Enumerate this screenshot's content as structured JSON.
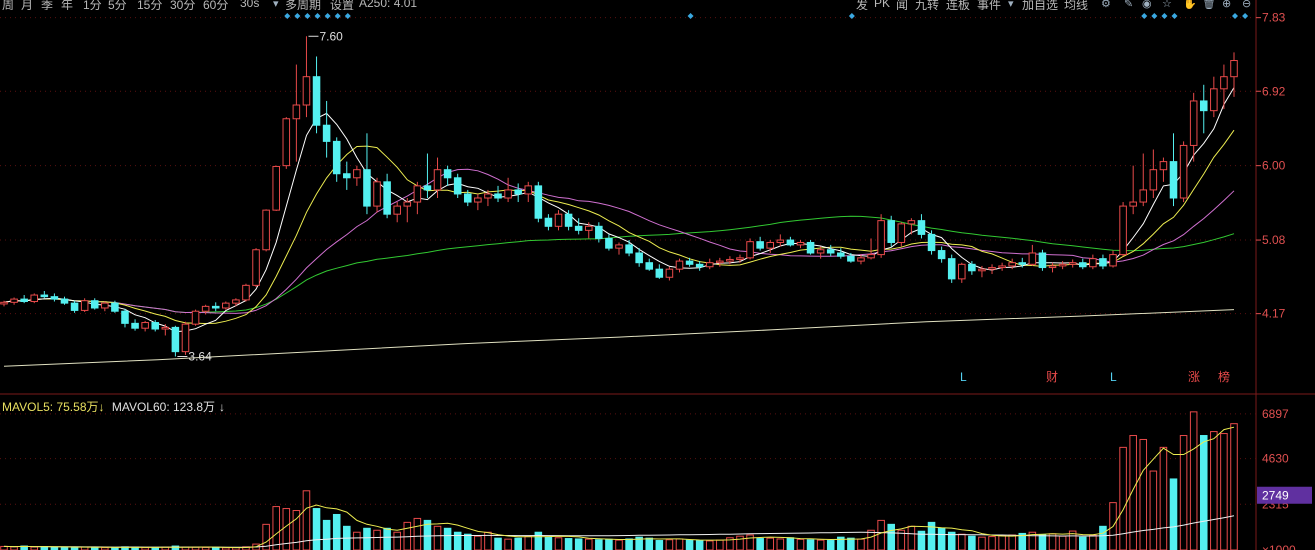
{
  "toolbar": {
    "items": [
      "周",
      "月",
      "季",
      "年",
      "1分",
      "5分",
      "15分",
      "30分",
      "60分",
      "30s",
      "多周期",
      "设置",
      "A250: 4.01"
    ],
    "right_items": [
      "发",
      "PK",
      "闻",
      "九转",
      "连板",
      "事件",
      "加自选",
      "均线"
    ]
  },
  "price_axis": {
    "labels": [
      "7.83",
      "6.92",
      "6.00",
      "5.08",
      "4.17"
    ]
  },
  "volume_axis": {
    "labels": [
      "6897",
      "4630",
      "2315",
      "×1000"
    ],
    "current": "2749"
  },
  "annotations": {
    "high": "7.60",
    "low": "3.64"
  },
  "markers": [
    "L",
    "财",
    "L",
    "涨",
    "榜"
  ],
  "volume_legend": {
    "ma5": "MAVOL5: 75.58万",
    "ma60": "MAVOL60: 123.8万"
  },
  "colors": {
    "up": "#e84a4a",
    "down": "#54f0f0",
    "ma5": "#ffffff",
    "ma10": "#ecec50",
    "ma20": "#d070d0",
    "ma60": "#32c832",
    "ma250": "#e0e0c0",
    "highlight": "#6030a0"
  },
  "icons": [
    "gear-icon",
    "pen-icon",
    "eye-icon",
    "star-icon",
    "hand-icon",
    "trash-icon",
    "plus-icon",
    "minus-icon"
  ],
  "chart_data": {
    "type": "candlestick",
    "ylim": [
      3.3,
      7.9
    ],
    "volume_ylim": [
      0,
      7600
    ],
    "candles": [
      [
        4.29,
        4.33,
        4.26,
        4.31
      ],
      [
        4.31,
        4.37,
        4.28,
        4.35
      ],
      [
        4.35,
        4.4,
        4.3,
        4.32
      ],
      [
        4.32,
        4.42,
        4.3,
        4.4
      ],
      [
        4.4,
        4.45,
        4.36,
        4.38
      ],
      [
        4.38,
        4.42,
        4.32,
        4.35
      ],
      [
        4.35,
        4.38,
        4.28,
        4.3
      ],
      [
        4.3,
        4.33,
        4.18,
        4.21
      ],
      [
        4.21,
        4.36,
        4.19,
        4.33
      ],
      [
        4.33,
        4.36,
        4.22,
        4.24
      ],
      [
        4.24,
        4.32,
        4.2,
        4.3
      ],
      [
        4.3,
        4.33,
        4.18,
        4.2
      ],
      [
        4.2,
        4.23,
        4.0,
        4.05
      ],
      [
        4.05,
        4.1,
        3.96,
        3.99
      ],
      [
        3.99,
        4.08,
        3.95,
        4.06
      ],
      [
        4.06,
        4.09,
        3.95,
        3.98
      ],
      [
        3.98,
        4.04,
        3.9,
        4.0
      ],
      [
        4.0,
        4.02,
        3.64,
        3.7
      ],
      [
        3.7,
        4.07,
        3.66,
        4.04
      ],
      [
        4.04,
        4.22,
        4.02,
        4.2
      ],
      [
        4.2,
        4.28,
        4.16,
        4.26
      ],
      [
        4.26,
        4.31,
        4.2,
        4.24
      ],
      [
        4.24,
        4.32,
        4.22,
        4.3
      ],
      [
        4.3,
        4.36,
        4.26,
        4.34
      ],
      [
        4.34,
        4.54,
        4.32,
        4.52
      ],
      [
        4.52,
        4.98,
        4.5,
        4.96
      ],
      [
        4.96,
        5.46,
        4.94,
        5.45
      ],
      [
        5.45,
        6.0,
        5.44,
        5.99
      ],
      [
        6.0,
        6.6,
        5.96,
        6.58
      ],
      [
        6.58,
        7.25,
        6.05,
        6.75
      ],
      [
        6.75,
        7.6,
        6.6,
        7.1
      ],
      [
        7.1,
        7.35,
        6.4,
        6.5
      ],
      [
        6.5,
        6.8,
        6.1,
        6.3
      ],
      [
        6.3,
        6.35,
        5.8,
        5.9
      ],
      [
        5.9,
        6.05,
        5.7,
        5.85
      ],
      [
        5.85,
        6.0,
        5.75,
        5.95
      ],
      [
        5.95,
        6.4,
        5.4,
        5.5
      ],
      [
        5.5,
        5.85,
        5.42,
        5.8
      ],
      [
        5.8,
        5.9,
        5.35,
        5.4
      ],
      [
        5.4,
        5.55,
        5.3,
        5.5
      ],
      [
        5.5,
        5.6,
        5.3,
        5.55
      ],
      [
        5.55,
        5.8,
        5.4,
        5.75
      ],
      [
        5.75,
        6.15,
        5.6,
        5.7
      ],
      [
        5.7,
        6.1,
        5.6,
        5.95
      ],
      [
        5.95,
        6.0,
        5.75,
        5.85
      ],
      [
        5.85,
        5.9,
        5.6,
        5.65
      ],
      [
        5.65,
        5.7,
        5.5,
        5.55
      ],
      [
        5.55,
        5.65,
        5.45,
        5.6
      ],
      [
        5.6,
        5.7,
        5.5,
        5.65
      ],
      [
        5.65,
        5.75,
        5.55,
        5.6
      ],
      [
        5.6,
        5.85,
        5.55,
        5.7
      ],
      [
        5.7,
        5.78,
        5.55,
        5.65
      ],
      [
        5.65,
        5.8,
        5.55,
        5.75
      ],
      [
        5.75,
        5.8,
        5.3,
        5.35
      ],
      [
        5.35,
        5.4,
        5.2,
        5.25
      ],
      [
        5.25,
        5.45,
        5.2,
        5.4
      ],
      [
        5.4,
        5.45,
        5.2,
        5.25
      ],
      [
        5.25,
        5.35,
        5.15,
        5.2
      ],
      [
        5.2,
        5.3,
        5.1,
        5.25
      ],
      [
        5.25,
        5.3,
        5.05,
        5.1
      ],
      [
        5.1,
        5.15,
        4.95,
        4.98
      ],
      [
        4.98,
        5.05,
        4.9,
        5.02
      ],
      [
        5.02,
        5.08,
        4.88,
        4.92
      ],
      [
        4.92,
        4.98,
        4.75,
        4.8
      ],
      [
        4.8,
        4.85,
        4.7,
        4.72
      ],
      [
        4.72,
        4.78,
        4.6,
        4.62
      ],
      [
        4.62,
        4.75,
        4.58,
        4.72
      ],
      [
        4.72,
        4.85,
        4.68,
        4.82
      ],
      [
        4.82,
        4.86,
        4.75,
        4.78
      ],
      [
        4.78,
        4.82,
        4.7,
        4.75
      ],
      [
        4.75,
        4.85,
        4.72,
        4.8
      ],
      [
        4.8,
        4.86,
        4.75,
        4.82
      ],
      [
        4.82,
        4.88,
        4.78,
        4.84
      ],
      [
        4.84,
        4.9,
        4.8,
        4.86
      ],
      [
        4.86,
        5.1,
        4.84,
        5.06
      ],
      [
        5.06,
        5.12,
        4.95,
        4.98
      ],
      [
        4.98,
        5.08,
        4.92,
        5.05
      ],
      [
        5.05,
        5.15,
        5.0,
        5.08
      ],
      [
        5.08,
        5.12,
        5.0,
        5.02
      ],
      [
        5.02,
        5.08,
        4.98,
        5.05
      ],
      [
        5.05,
        5.08,
        4.9,
        4.92
      ],
      [
        4.92,
        5.0,
        4.85,
        4.96
      ],
      [
        4.96,
        5.02,
        4.88,
        4.92
      ],
      [
        4.92,
        4.98,
        4.85,
        4.88
      ],
      [
        4.88,
        4.92,
        4.8,
        4.82
      ],
      [
        4.82,
        4.9,
        4.78,
        4.86
      ],
      [
        4.86,
        5.1,
        4.84,
        4.9
      ],
      [
        4.9,
        5.4,
        4.86,
        5.32
      ],
      [
        5.32,
        5.38,
        5.0,
        5.05
      ],
      [
        5.05,
        5.3,
        5.0,
        5.28
      ],
      [
        5.28,
        5.35,
        5.15,
        5.32
      ],
      [
        5.32,
        5.4,
        5.1,
        5.15
      ],
      [
        5.15,
        5.2,
        4.9,
        4.95
      ],
      [
        4.95,
        5.0,
        4.8,
        4.85
      ],
      [
        4.85,
        4.9,
        4.55,
        4.6
      ],
      [
        4.6,
        4.8,
        4.55,
        4.78
      ],
      [
        4.78,
        4.82,
        4.65,
        4.7
      ],
      [
        4.7,
        4.76,
        4.62,
        4.72
      ],
      [
        4.72,
        4.78,
        4.66,
        4.74
      ],
      [
        4.74,
        4.8,
        4.7,
        4.76
      ],
      [
        4.76,
        4.85,
        4.72,
        4.8
      ],
      [
        4.8,
        4.86,
        4.74,
        4.78
      ],
      [
        4.78,
        5.02,
        4.76,
        4.92
      ],
      [
        4.92,
        4.96,
        4.7,
        4.74
      ],
      [
        4.74,
        4.8,
        4.68,
        4.76
      ],
      [
        4.76,
        4.82,
        4.72,
        4.78
      ],
      [
        4.78,
        4.84,
        4.74,
        4.8
      ],
      [
        4.8,
        4.85,
        4.72,
        4.75
      ],
      [
        4.75,
        4.9,
        4.72,
        4.85
      ],
      [
        4.85,
        4.9,
        4.72,
        4.76
      ],
      [
        4.76,
        4.95,
        4.74,
        4.9
      ],
      [
        4.9,
        5.55,
        4.88,
        5.5
      ],
      [
        5.5,
        6.0,
        5.4,
        5.55
      ],
      [
        5.55,
        6.15,
        5.5,
        5.7
      ],
      [
        5.7,
        6.2,
        5.6,
        5.95
      ],
      [
        5.95,
        6.1,
        5.8,
        6.05
      ],
      [
        6.05,
        6.4,
        5.5,
        5.6
      ],
      [
        5.6,
        6.3,
        5.55,
        6.25
      ],
      [
        6.25,
        6.9,
        6.05,
        6.8
      ],
      [
        6.8,
        7.0,
        6.4,
        6.68
      ],
      [
        6.68,
        7.1,
        6.6,
        6.95
      ],
      [
        6.95,
        7.25,
        6.7,
        7.1
      ],
      [
        7.1,
        7.4,
        6.85,
        7.3
      ]
    ],
    "volumes": [
      180,
      160,
      200,
      150,
      170,
      140,
      130,
      150,
      150,
      130,
      120,
      110,
      160,
      150,
      120,
      110,
      140,
      200,
      150,
      140,
      130,
      120,
      110,
      120,
      160,
      300,
      1300,
      2200,
      2100,
      2000,
      3000,
      2100,
      1500,
      1800,
      1200,
      900,
      1100,
      1000,
      1100,
      900,
      1400,
      1600,
      1500,
      1200,
      1100,
      900,
      800,
      700,
      900,
      600,
      550,
      600,
      700,
      900,
      650,
      620,
      580,
      560,
      550,
      520,
      540,
      500,
      560,
      650,
      600,
      480,
      520,
      560,
      500,
      480,
      460,
      500,
      620,
      700,
      760,
      580,
      600,
      560,
      620,
      540,
      520,
      500,
      480,
      650,
      600,
      550,
      1000,
      1500,
      1300,
      1000,
      1200,
      950,
      1400,
      1100,
      900,
      800,
      700,
      650,
      680,
      720,
      760,
      840,
      900,
      780,
      820,
      700,
      960,
      650,
      750,
      1200,
      2400,
      5200,
      5800,
      5600,
      4000,
      5200,
      3600,
      5800,
      7000,
      5800,
      6000,
      5900,
      6400
    ],
    "series": [
      {
        "name": "MA250",
        "values": [
          3.52,
          3.6,
          3.7,
          3.8,
          3.88,
          3.97,
          4.07,
          4.14,
          4.22
        ]
      }
    ],
    "markers": [
      "L",
      "财",
      "L",
      "涨",
      "榜"
    ]
  }
}
